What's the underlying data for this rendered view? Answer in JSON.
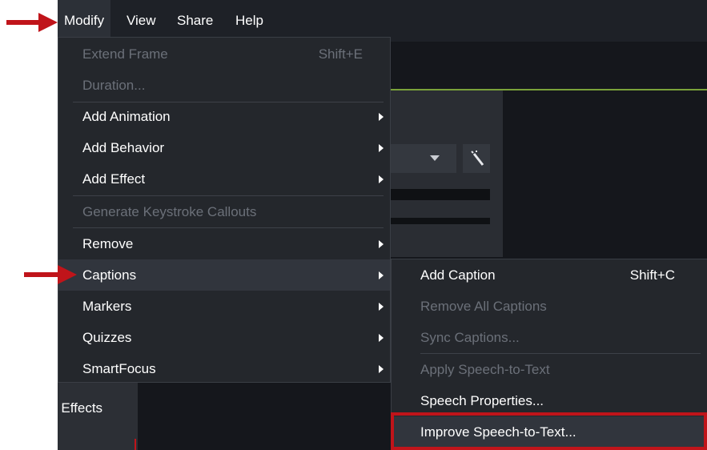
{
  "menubar": [
    "Modify",
    "View",
    "Share",
    "Help"
  ],
  "modify_menu": [
    {
      "label": "Extend Frame",
      "shortcut": "Shift+E",
      "disabled": true
    },
    {
      "label": "Duration...",
      "disabled": true
    },
    {
      "label": "Add Animation",
      "submenu": true
    },
    {
      "label": "Add Behavior",
      "submenu": true
    },
    {
      "label": "Add Effect",
      "submenu": true
    },
    {
      "label": "Generate Keystroke Callouts",
      "disabled": true
    },
    {
      "label": "Remove",
      "submenu": true
    },
    {
      "label": "Captions",
      "submenu": true,
      "highlighted": true
    },
    {
      "label": "Markers",
      "submenu": true
    },
    {
      "label": "Quizzes",
      "submenu": true
    },
    {
      "label": "SmartFocus",
      "submenu": true
    }
  ],
  "captions_submenu": [
    {
      "label": "Add Caption",
      "shortcut": "Shift+C"
    },
    {
      "label": "Remove All Captions",
      "disabled": true
    },
    {
      "label": "Sync Captions...",
      "disabled": true
    },
    {
      "label": "Apply Speech-to-Text",
      "disabled": true
    },
    {
      "label": "Speech Properties..."
    },
    {
      "label": "Improve Speech-to-Text...",
      "highlighted": true
    }
  ],
  "background_panel": {
    "effects_label": "r Effects"
  },
  "colors": {
    "arrow": "#c0141a",
    "accent_line": "#7aa23a"
  }
}
